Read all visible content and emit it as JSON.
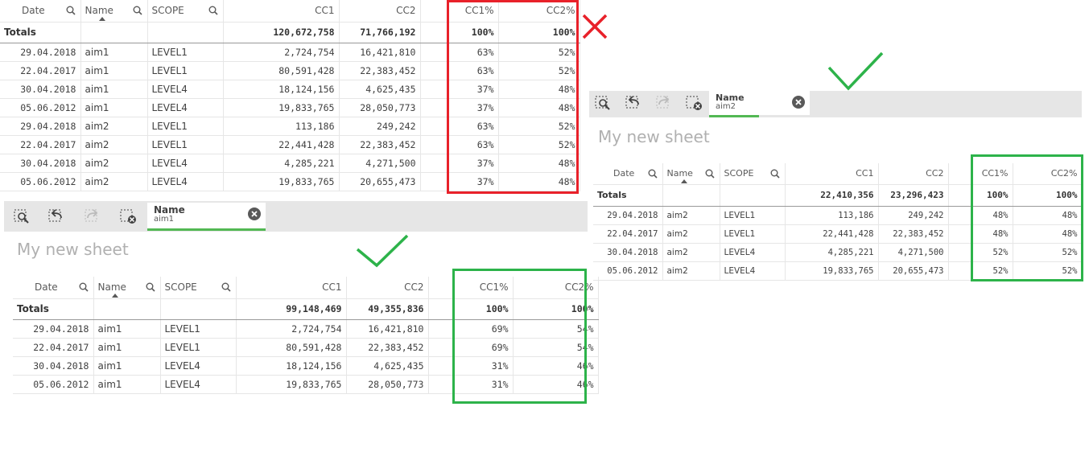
{
  "columns": {
    "date": "Date",
    "name": "Name",
    "scope": "SCOPE",
    "cc1": "CC1",
    "cc2": "CC2",
    "cc1p": "CC1%",
    "cc2p": "CC2%"
  },
  "totals_label": "Totals",
  "colors": {
    "red_mark": "#e8212a",
    "green_mark": "#2db34a",
    "selection_green": "#52b853"
  },
  "marks": {
    "cross": "✕",
    "check": "✓"
  },
  "table1": {
    "totals": {
      "cc1": "120,672,758",
      "cc2": "71,766,192",
      "cc1p": "100%",
      "cc2p": "100%"
    },
    "rows": [
      {
        "date": "29.04.2018",
        "name": "aim1",
        "scope": "LEVEL1",
        "cc1": "2,724,754",
        "cc2": "16,421,810",
        "cc1p": "63%",
        "cc2p": "52%"
      },
      {
        "date": "22.04.2017",
        "name": "aim1",
        "scope": "LEVEL1",
        "cc1": "80,591,428",
        "cc2": "22,383,452",
        "cc1p": "63%",
        "cc2p": "52%"
      },
      {
        "date": "30.04.2018",
        "name": "aim1",
        "scope": "LEVEL4",
        "cc1": "18,124,156",
        "cc2": "4,625,435",
        "cc1p": "37%",
        "cc2p": "48%"
      },
      {
        "date": "05.06.2012",
        "name": "aim1",
        "scope": "LEVEL4",
        "cc1": "19,833,765",
        "cc2": "28,050,773",
        "cc1p": "37%",
        "cc2p": "48%"
      },
      {
        "date": "29.04.2018",
        "name": "aim2",
        "scope": "LEVEL1",
        "cc1": "113,186",
        "cc2": "249,242",
        "cc1p": "63%",
        "cc2p": "52%"
      },
      {
        "date": "22.04.2017",
        "name": "aim2",
        "scope": "LEVEL1",
        "cc1": "22,441,428",
        "cc2": "22,383,452",
        "cc1p": "63%",
        "cc2p": "52%"
      },
      {
        "date": "30.04.2018",
        "name": "aim2",
        "scope": "LEVEL4",
        "cc1": "4,285,221",
        "cc2": "4,271,500",
        "cc1p": "37%",
        "cc2p": "48%"
      },
      {
        "date": "05.06.2012",
        "name": "aim2",
        "scope": "LEVEL4",
        "cc1": "19,833,765",
        "cc2": "20,655,473",
        "cc1p": "37%",
        "cc2p": "48%"
      }
    ]
  },
  "sheet_aim1": {
    "selection": {
      "field": "Name",
      "value": "aim1"
    },
    "sheet_title": "My new sheet",
    "totals": {
      "cc1": "99,148,469",
      "cc2": "49,355,836",
      "cc1p": "100%",
      "cc2p": "100%"
    },
    "rows": [
      {
        "date": "29.04.2018",
        "name": "aim1",
        "scope": "LEVEL1",
        "cc1": "2,724,754",
        "cc2": "16,421,810",
        "cc1p": "69%",
        "cc2p": "54%"
      },
      {
        "date": "22.04.2017",
        "name": "aim1",
        "scope": "LEVEL1",
        "cc1": "80,591,428",
        "cc2": "22,383,452",
        "cc1p": "69%",
        "cc2p": "54%"
      },
      {
        "date": "30.04.2018",
        "name": "aim1",
        "scope": "LEVEL4",
        "cc1": "18,124,156",
        "cc2": "4,625,435",
        "cc1p": "31%",
        "cc2p": "46%"
      },
      {
        "date": "05.06.2012",
        "name": "aim1",
        "scope": "LEVEL4",
        "cc1": "19,833,765",
        "cc2": "28,050,773",
        "cc1p": "31%",
        "cc2p": "46%"
      }
    ]
  },
  "sheet_aim2": {
    "selection": {
      "field": "Name",
      "value": "aim2"
    },
    "sheet_title": "My new sheet",
    "totals": {
      "cc1": "22,410,356",
      "cc2": "23,296,423",
      "cc1p": "100%",
      "cc2p": "100%"
    },
    "rows": [
      {
        "date": "29.04.2018",
        "name": "aim2",
        "scope": "LEVEL1",
        "cc1": "113,186",
        "cc2": "249,242",
        "cc1p": "48%",
        "cc2p": "48%"
      },
      {
        "date": "22.04.2017",
        "name": "aim2",
        "scope": "LEVEL1",
        "cc1": "22,441,428",
        "cc2": "22,383,452",
        "cc1p": "48%",
        "cc2p": "48%"
      },
      {
        "date": "30.04.2018",
        "name": "aim2",
        "scope": "LEVEL4",
        "cc1": "4,285,221",
        "cc2": "4,271,500",
        "cc1p": "52%",
        "cc2p": "52%"
      },
      {
        "date": "05.06.2012",
        "name": "aim2",
        "scope": "LEVEL4",
        "cc1": "19,833,765",
        "cc2": "20,655,473",
        "cc1p": "52%",
        "cc2p": "52%"
      }
    ]
  }
}
